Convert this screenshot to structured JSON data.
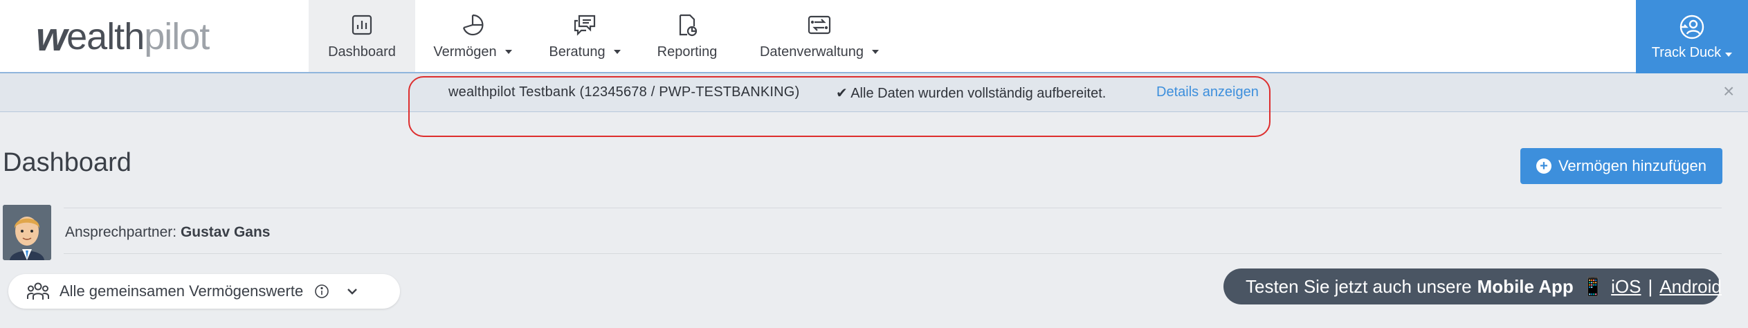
{
  "logo": {
    "part_w": "w",
    "part_ealth": "ealth",
    "part_pilot": "pilot"
  },
  "nav": {
    "items": [
      {
        "label": "Dashboard",
        "icon": "bar-chart-icon",
        "active": true
      },
      {
        "label": "Vermögen",
        "icon": "pie-chart-icon",
        "dropdown": true
      },
      {
        "label": "Beratung",
        "icon": "chat-bubbles-icon",
        "dropdown": true
      },
      {
        "label": "Reporting",
        "icon": "report-document-icon"
      },
      {
        "label": "Datenverwaltung",
        "icon": "data-transfer-icon",
        "dropdown": true
      }
    ],
    "user": {
      "name": "Track Duck",
      "icon": "user-switch-icon"
    }
  },
  "notice": {
    "bank": "wealthpilot Testbank (12345678 / PWP-TESTBANKING)",
    "status_check": "✔",
    "status": "Alle Daten wurden vollständig aufbereitet.",
    "details_link": "Details anzeigen",
    "close": "×"
  },
  "main": {
    "title": "Dashboard",
    "add_button": "Vermögen hinzufügen",
    "contact_label": "Ansprechpartner:",
    "contact_name": "Gustav Gans",
    "filter_label": "Alle gemeinsamen Vermögenswerte"
  },
  "app_banner": {
    "text_prefix": "Testen Sie jetzt auch unsere",
    "text_bold": "Mobile App",
    "phone_glyph": "📱",
    "ios": "iOS",
    "separator": "|",
    "android": "Android"
  },
  "colors": {
    "accent": "#3d8fdc",
    "highlight": "#dd2e2e",
    "banner_bg": "#4a5563",
    "page_bg": "#ebedf0"
  }
}
